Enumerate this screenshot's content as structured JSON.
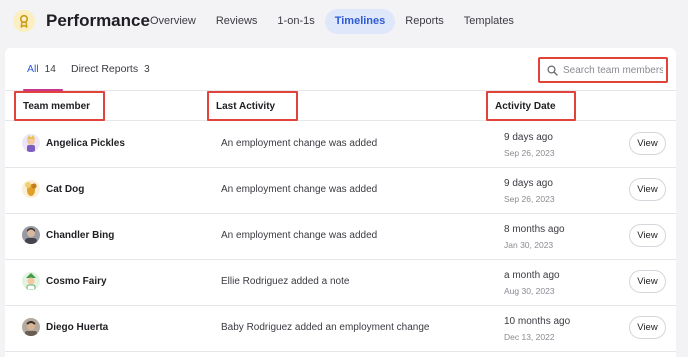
{
  "app": {
    "title": "Performance",
    "logo_icon": "award-ribbon-icon"
  },
  "nav": [
    "Overview",
    "Reviews",
    "1-on-1s",
    "Timelines",
    "Reports",
    "Templates"
  ],
  "nav_active": "Timelines",
  "filters": [
    {
      "label": "All",
      "count": "14",
      "active": true
    },
    {
      "label": "Direct Reports",
      "count": "3",
      "active": false
    }
  ],
  "search": {
    "placeholder": "Search team members..."
  },
  "columns": {
    "member": "Team member",
    "activity": "Last Activity",
    "date": "Activity Date"
  },
  "rows": [
    {
      "name": "Angelica Pickles",
      "activity": "An employment change was added",
      "date_rel": "9 days ago",
      "date_abs": "Sep 26, 2023",
      "action": "View",
      "avatar_color": "#7c5cbf"
    },
    {
      "name": "Cat Dog",
      "activity": "An employment change was added",
      "date_rel": "9 days ago",
      "date_abs": "Sep 26, 2023",
      "action": "View",
      "avatar_color": "#e0a02a"
    },
    {
      "name": "Chandler Bing",
      "activity": "An employment change was added",
      "date_rel": "8 months ago",
      "date_abs": "Jan 30, 2023",
      "action": "View",
      "avatar_color": "#5a5a62"
    },
    {
      "name": "Cosmo Fairy",
      "activity": "Ellie Rodriguez added a note",
      "date_rel": "a month ago",
      "date_abs": "Aug 30, 2023",
      "action": "View",
      "avatar_color": "#3f9a4a"
    },
    {
      "name": "Diego Huerta",
      "activity": "Baby Rodriguez added an employment change",
      "date_rel": "10 months ago",
      "date_abs": "Dec 13, 2022",
      "action": "View",
      "avatar_color": "#7d6f64"
    }
  ],
  "colors": {
    "accent": "#2f5bd3",
    "nav_active_bg": "#dfe7fb",
    "tab_underline": "#c7368c",
    "highlight_border": "#e0433a",
    "logo_bg": "#fbeec0",
    "logo_fg": "#c99a1a"
  }
}
